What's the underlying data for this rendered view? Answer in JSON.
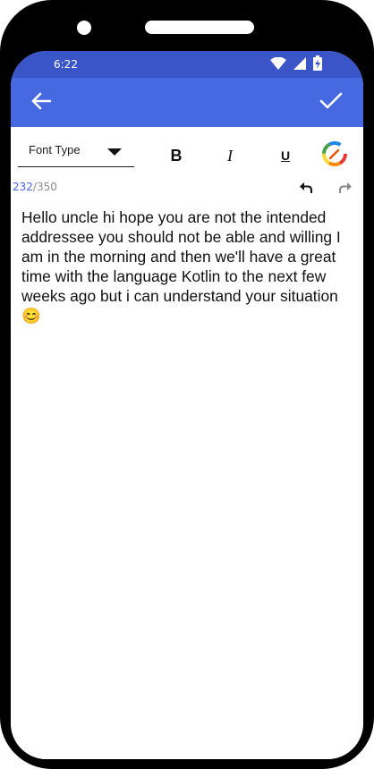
{
  "status_bar": {
    "time": "6:22",
    "icons": [
      "wifi-icon",
      "signal-icon",
      "battery-icon"
    ]
  },
  "app_bar": {
    "back_icon": "arrow-left-icon",
    "done_icon": "check-icon",
    "background": "#4668e1",
    "status_background": "#3a55c8"
  },
  "toolbar": {
    "font_type_label": "Font Type",
    "bold_label": "B",
    "italic_label": "I",
    "underline_label": "U",
    "color_picker_icon": "color-wheel-icon"
  },
  "counter": {
    "current": "232",
    "separator_max": "/350"
  },
  "history": {
    "undo_icon": "undo-icon",
    "redo_icon": "redo-icon"
  },
  "editor": {
    "text": "Hello uncle hi hope you are not the intended addressee you should not be able and willing I am in the morning and then we'll have a great time with the language Kotlin to the next few weeks ago but i can understand your situation 😊"
  }
}
